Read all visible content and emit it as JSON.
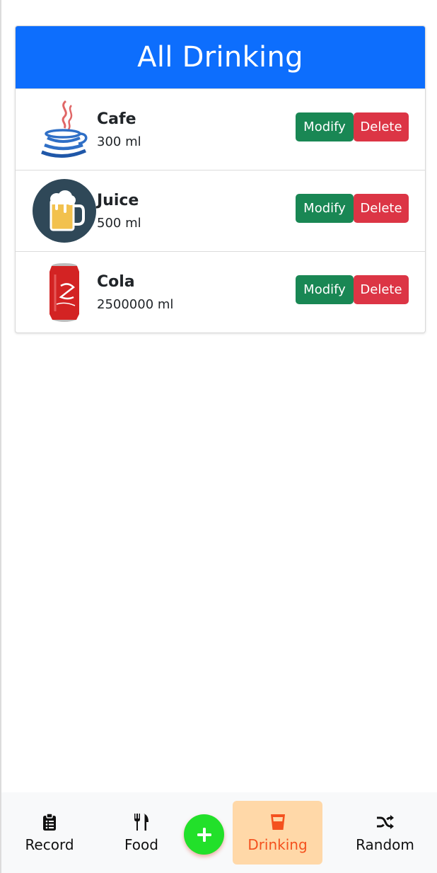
{
  "header": {
    "title": "All Drinking"
  },
  "items": [
    {
      "name": "Cafe",
      "volume": "300 ml",
      "icon": "java-coffee-cup-icon",
      "modify_label": "Modify",
      "delete_label": "Delete"
    },
    {
      "name": "Juice",
      "volume": "500 ml",
      "icon": "beer-mug-icon",
      "modify_label": "Modify",
      "delete_label": "Delete"
    },
    {
      "name": "Cola",
      "volume": "2500000 ml",
      "icon": "cola-can-icon",
      "modify_label": "Modify",
      "delete_label": "Delete"
    }
  ],
  "nav": {
    "record": {
      "label": "Record",
      "icon": "clipboard-icon"
    },
    "food": {
      "label": "Food",
      "icon": "utensils-icon"
    },
    "add": {
      "icon": "plus-icon"
    },
    "drinking": {
      "label": "Drinking",
      "icon": "glass-icon",
      "active": true
    },
    "random": {
      "label": "Random",
      "icon": "shuffle-icon"
    }
  },
  "colors": {
    "header_bg": "#0d6efd",
    "modify_bg": "#198754",
    "delete_bg": "#dc3545",
    "add_bg": "#22e02a",
    "active_nav_bg": "#ffd8a8",
    "active_nav_text": "#f4511e"
  }
}
